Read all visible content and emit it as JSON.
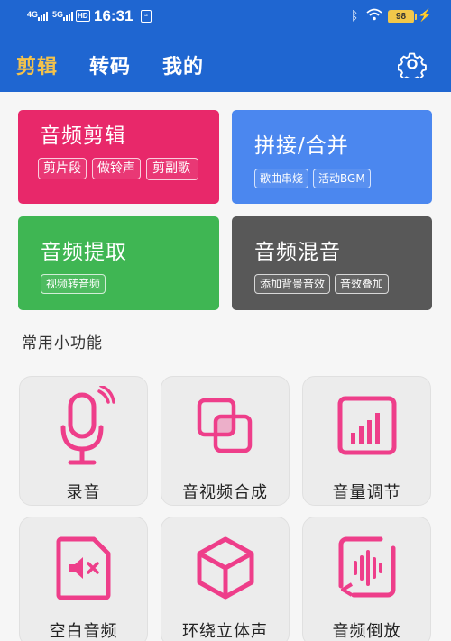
{
  "status_bar": {
    "sig1": "4G",
    "sig2": "5G",
    "hd": "HD",
    "time": "16:31",
    "vib": "≈",
    "battery": "98"
  },
  "tabs": [
    {
      "label": "剪辑",
      "active": true
    },
    {
      "label": "转码",
      "active": false
    },
    {
      "label": "我的",
      "active": false
    }
  ],
  "colors": {
    "header": "#1f66d1",
    "active_tab": "#f3c24c",
    "card_edit": "#e8286a",
    "card_join": "#4b87ef",
    "card_extract": "#3fb653",
    "card_mix": "#585858",
    "icon_pink": "#ee3e8a"
  },
  "cards": {
    "edit": {
      "title": "音频剪辑",
      "chips": [
        "剪片段",
        "做铃声",
        "剪副歌"
      ]
    },
    "join": {
      "title": "拼接/合并",
      "chips": [
        "歌曲串烧",
        "活动BGM"
      ]
    },
    "extract": {
      "title": "音频提取",
      "chips": [
        "视频转音频"
      ]
    },
    "mix": {
      "title": "音频混音",
      "chips": [
        "添加背景音效",
        "音效叠加"
      ]
    }
  },
  "section": {
    "title": "常用小功能"
  },
  "tools": [
    {
      "label": "录音",
      "icon": "microphone-icon"
    },
    {
      "label": "音视频合成",
      "icon": "merge-icon"
    },
    {
      "label": "音量调节",
      "icon": "volume-bars-icon"
    },
    {
      "label": "空白音频",
      "icon": "mute-file-icon"
    },
    {
      "label": "环绕立体声",
      "icon": "cube-icon"
    },
    {
      "label": "音频倒放",
      "icon": "reverse-wave-icon"
    }
  ]
}
